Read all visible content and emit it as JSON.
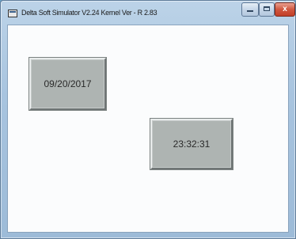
{
  "window": {
    "title": "Delta Soft Simulator V2.24 Kernel Ver - R 2.83",
    "controls": {
      "minimize": "minimize",
      "maximize": "maximize",
      "close": "x"
    }
  },
  "display": {
    "date": "09/20/2017",
    "time": "23:32:31"
  },
  "colors": {
    "field_bg": "#aeb4b2",
    "client_bg": "#fbfcfd",
    "close_button": "#c23e28"
  }
}
